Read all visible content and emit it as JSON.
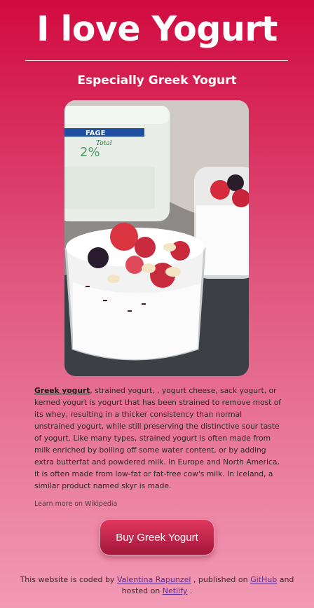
{
  "header": {
    "title": "I love Yogurt",
    "subtitle": "Especially Greek Yogurt"
  },
  "hero_image": {
    "icon": "greek-yogurt-photo",
    "container_label": "FAGE",
    "container_sublabel": "Total",
    "container_fat": "2%"
  },
  "description": {
    "link_text": "Greek yogurt",
    "body": ", strained yogurt, , yogurt cheese, sack yogurt, or kerned yogurt is yogurt that has been strained to remove most of its whey, resulting in a thicker consistency than normal unstrained yogurt, while still preserving the distinctive sour taste of yogurt. Like many types, strained yogurt is often made from milk enriched by boiling off some water content, or by adding extra butterfat and powdered milk. In Europe and North America, it is often made from low-fat or fat-free cow's milk. In Iceland, a similar product named skyr is made."
  },
  "learn_more": "Learn more on Wikipedia",
  "cta": {
    "label": "Buy Greek Yogurt"
  },
  "footer": {
    "text_1": "This website is coded by ",
    "author": "Valentina Rapunzel",
    "text_2": " , published on ",
    "github": "GitHub",
    "text_3": " and hosted on ",
    "netlify": "Netlify",
    "text_4": " ."
  },
  "colors": {
    "bg_top": "#d10a3f",
    "bg_bottom": "#f29ab5",
    "button_top": "#e0375f",
    "button_bottom": "#a3163a",
    "link": "#5b2b8c"
  }
}
